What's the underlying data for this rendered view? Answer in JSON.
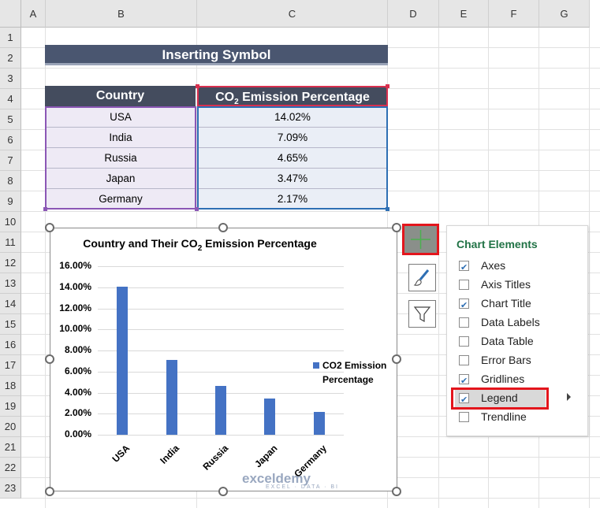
{
  "sheet": {
    "columns": [
      "A",
      "B",
      "C",
      "D",
      "E",
      "F",
      "G"
    ],
    "rows": [
      "1",
      "2",
      "3",
      "4",
      "5",
      "6",
      "7",
      "8",
      "9",
      "10",
      "11",
      "12",
      "13",
      "14",
      "15",
      "16",
      "17",
      "18",
      "19",
      "20",
      "21",
      "22",
      "23"
    ]
  },
  "title_cell": "Inserting Symbol",
  "table": {
    "header_country": "Country",
    "header_emission_pre": "CO",
    "header_emission_sub": "2",
    "header_emission_post": " Emission Percentage",
    "rows": [
      {
        "country": "USA",
        "pct": "14.02%"
      },
      {
        "country": "India",
        "pct": "7.09%"
      },
      {
        "country": "Russia",
        "pct": "4.65%"
      },
      {
        "country": "Japan",
        "pct": "3.47%"
      },
      {
        "country": "Germany",
        "pct": "2.17%"
      }
    ]
  },
  "chart_data": {
    "type": "bar",
    "title_pre": "Country and Their CO",
    "title_sub": "2",
    "title_post": " Emission Percentage",
    "categories": [
      "USA",
      "India",
      "Russia",
      "Japan",
      "Germany"
    ],
    "series": [
      {
        "name": "CO2 Emission Percentage",
        "values": [
          14.02,
          7.09,
          4.65,
          3.47,
          2.17
        ]
      }
    ],
    "yticks": [
      "0.00%",
      "2.00%",
      "4.00%",
      "6.00%",
      "8.00%",
      "10.00%",
      "12.00%",
      "14.00%",
      "16.00%"
    ],
    "ylim": [
      0,
      16
    ],
    "grid": true,
    "legend_position": "right",
    "legend_line1": "CO2 Emission",
    "legend_line2": "Percentage",
    "bar_color": "#4472c4"
  },
  "chart_buttons": {
    "elements": "plus-icon",
    "styles": "brush-icon",
    "filters": "filter-icon"
  },
  "chart_elements_panel": {
    "title": "Chart Elements",
    "items": [
      {
        "label": "Axes",
        "checked": true
      },
      {
        "label": "Axis Titles",
        "checked": false
      },
      {
        "label": "Chart Title",
        "checked": true
      },
      {
        "label": "Data Labels",
        "checked": false
      },
      {
        "label": "Data Table",
        "checked": false
      },
      {
        "label": "Error Bars",
        "checked": false
      },
      {
        "label": "Gridlines",
        "checked": true
      },
      {
        "label": "Legend",
        "checked": true
      },
      {
        "label": "Trendline",
        "checked": false
      }
    ]
  },
  "watermark": {
    "name": "exceldemy",
    "tagline": "EXCEL · DATA · BI"
  },
  "colors": {
    "accent_red": "#e3151c",
    "panel_title": "#217346",
    "header_fill": "#444c5e"
  }
}
